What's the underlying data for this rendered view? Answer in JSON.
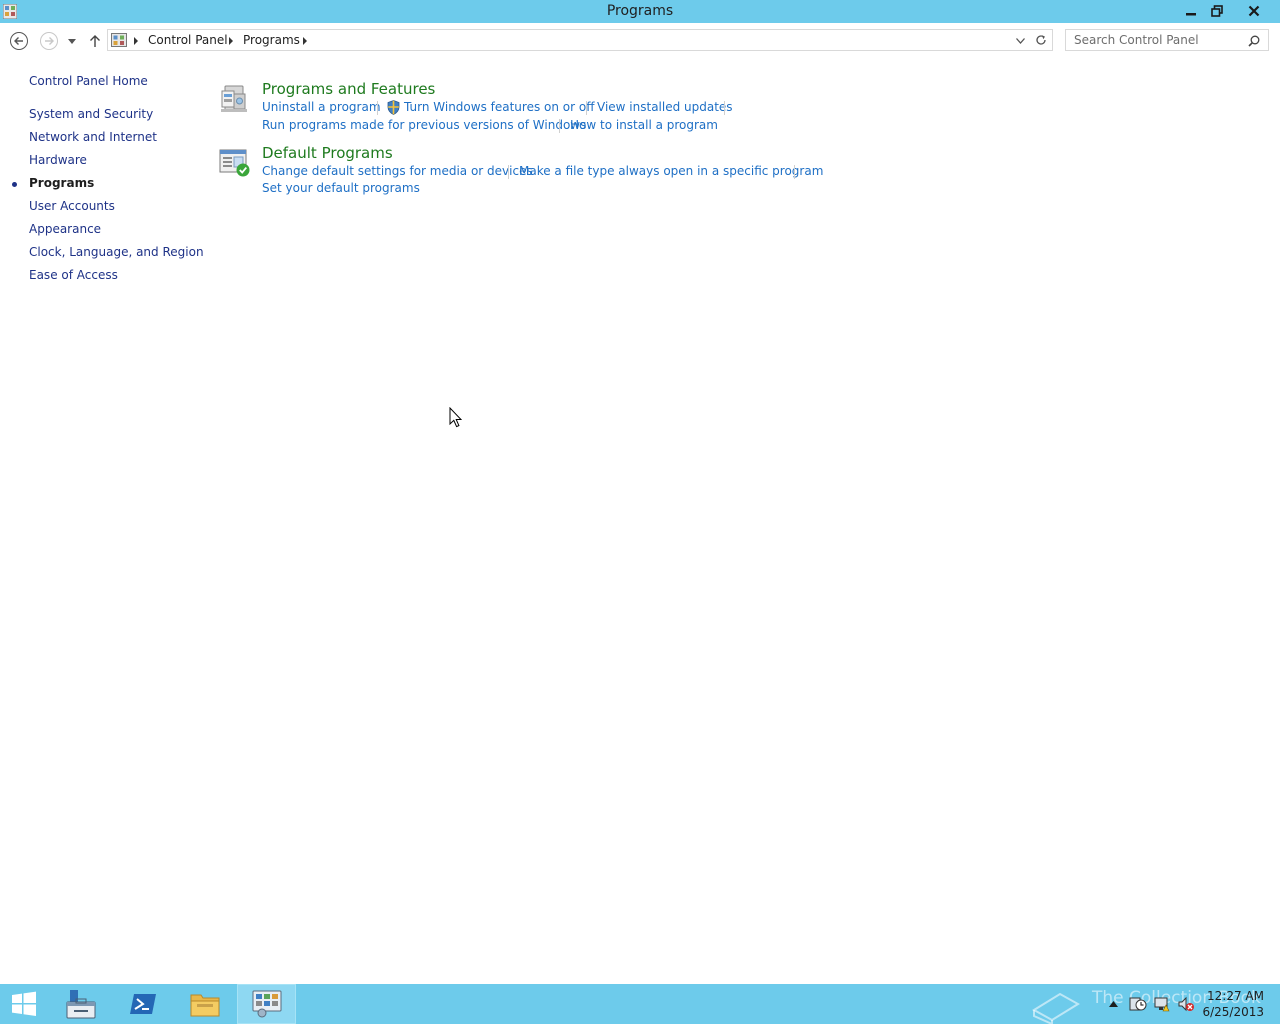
{
  "window": {
    "title": "Programs"
  },
  "titlebar_buttons": {
    "minimize": "minimize-icon",
    "restore": "restore-icon",
    "close": "close-icon"
  },
  "address": {
    "crumbs": [
      "Control Panel",
      "Programs"
    ]
  },
  "search": {
    "placeholder": "Search Control Panel"
  },
  "leftnav": {
    "home": "Control Panel Home",
    "items": [
      "System and Security",
      "Network and Internet",
      "Hardware",
      "Programs",
      "User Accounts",
      "Appearance",
      "Clock, Language, and Region",
      "Ease of Access"
    ],
    "current": "Programs"
  },
  "sections": [
    {
      "title": "Programs and Features",
      "icon": "programs-features-icon",
      "links": [
        "Uninstall a program",
        "Turn Windows features on or off",
        "View installed updates",
        "Run programs made for previous versions of Windows",
        "How to install a program"
      ]
    },
    {
      "title": "Default Programs",
      "icon": "default-programs-icon",
      "links": [
        "Change default settings for media or devices",
        "Make a file type always open in a specific program",
        "Set your default programs"
      ]
    }
  ],
  "taskbar": {
    "watermark": "The Collection Book",
    "time": "12:27 AM",
    "date": "6/25/2013"
  },
  "colors": {
    "titlebar": "#6dcbeb",
    "link": "#1e6fc5",
    "section_title": "#1e7a1e",
    "nav_link": "#1e3287"
  }
}
